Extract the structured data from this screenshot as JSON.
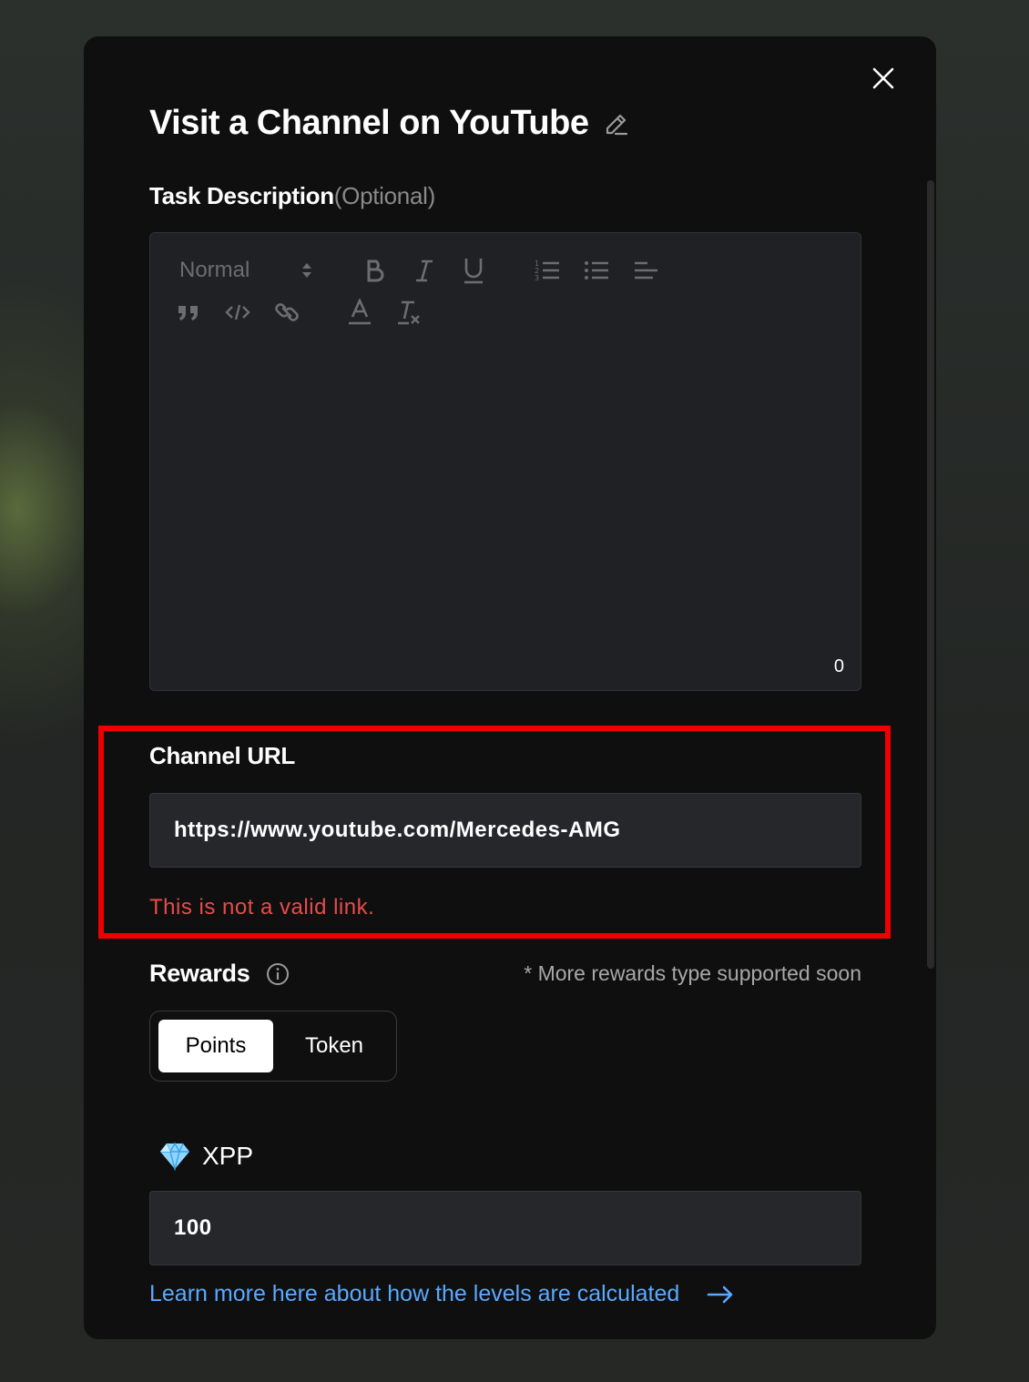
{
  "modal": {
    "title": "Visit a Channel on YouTube"
  },
  "description": {
    "label": "Task Description",
    "optional": "(Optional)",
    "format_select": "Normal",
    "char_count": "0"
  },
  "channel": {
    "label": "Channel URL",
    "value": "https://www.youtube.com/Mercedes-AMG",
    "error": "This is not a valid link."
  },
  "rewards": {
    "label": "Rewards",
    "note": "* More rewards type supported soon",
    "options": [
      "Points",
      "Token"
    ],
    "selected": "Points"
  },
  "xpp": {
    "label": "XPP",
    "value": "100"
  },
  "learn_more": "Learn more here about how the levels are calculated",
  "colors": {
    "error": "#e94b4b",
    "link": "#5aa9ff",
    "highlight": "#ee0000"
  }
}
